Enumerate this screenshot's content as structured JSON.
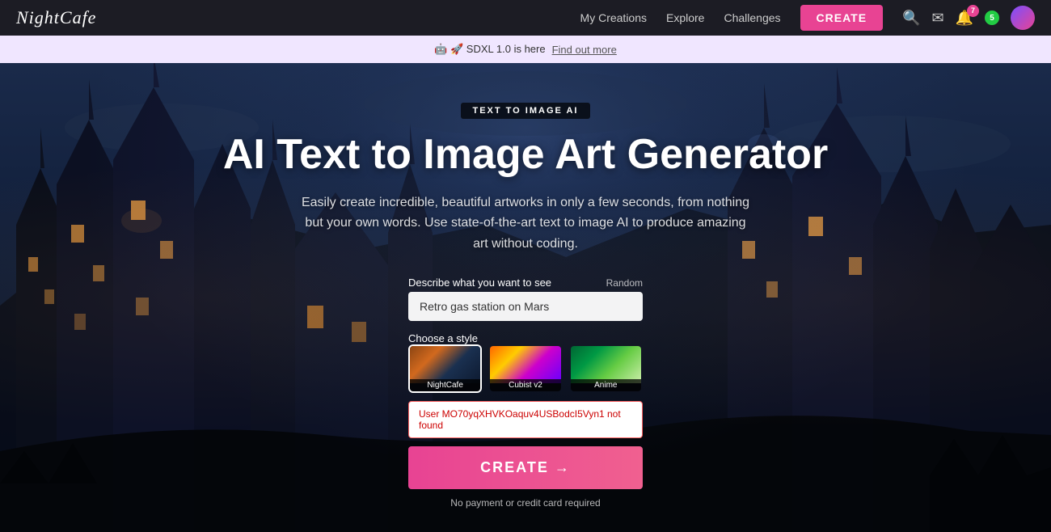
{
  "nav": {
    "logo": "NightCafe",
    "links": [
      {
        "label": "My Creations",
        "id": "my-creations"
      },
      {
        "label": "Explore",
        "id": "explore"
      },
      {
        "label": "Challenges",
        "id": "challenges"
      }
    ],
    "create_button": "CREATE",
    "notification_badge_1": "7",
    "notification_badge_2": "5"
  },
  "announcement": {
    "text": "🤖 🚀 SDXL 1.0 is here",
    "link_text": "Find out more"
  },
  "hero": {
    "badge": "TEXT TO IMAGE AI",
    "title": "AI Text to Image Art Generator",
    "subtitle": "Easily create incredible, beautiful artworks in only a few seconds, from nothing but your own words. Use state-of-the-art text to image AI to produce amazing art without coding.",
    "prompt_label": "Describe what you want to see",
    "random_label": "Random",
    "prompt_value": "Retro gas station on Mars",
    "style_label": "Choose a style",
    "styles": [
      {
        "id": "nightcafe",
        "label": "NightCafe",
        "selected": true
      },
      {
        "id": "cubist",
        "label": "Cubist v2",
        "selected": false
      },
      {
        "id": "anime",
        "label": "Anime",
        "selected": false
      }
    ],
    "error_text": "User MO70yqXHVKOaquv4USBodcI5Vyn1 not found",
    "create_button": "CREATE →",
    "no_payment_text": "No payment or credit card required"
  }
}
